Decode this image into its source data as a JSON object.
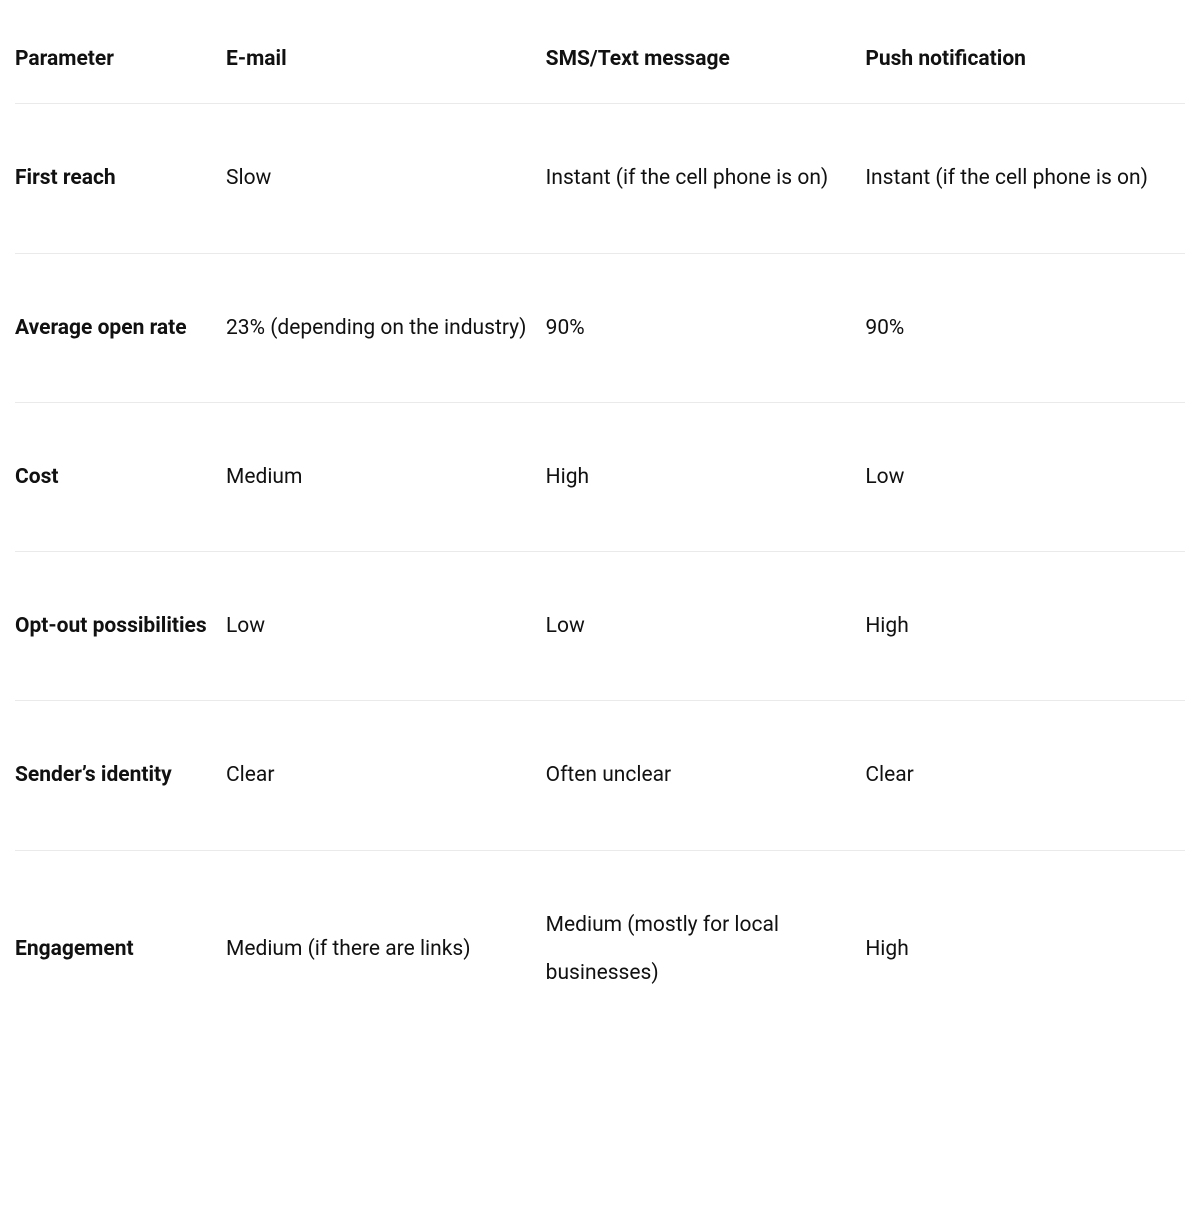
{
  "chart_data": {
    "type": "table",
    "title": "",
    "columns": [
      "Parameter",
      "E-mail",
      "SMS/Text message",
      "Push notification"
    ],
    "rows": [
      {
        "parameter": "First reach",
        "email": "Slow",
        "sms": "Instant (if the cell phone is on)",
        "push": "Instant (if the cell phone is on)"
      },
      {
        "parameter": "Average open rate",
        "email": "23% (depending on the industry)",
        "sms": "90%",
        "push": "90%"
      },
      {
        "parameter": "Cost",
        "email": "Medium",
        "sms": "High",
        "push": "Low"
      },
      {
        "parameter": "Opt-out possibilities",
        "email": "Low",
        "sms": "Low",
        "push": "High"
      },
      {
        "parameter": "Sender’s identity",
        "email": "Clear",
        "sms": "Often unclear",
        "push": "Clear"
      },
      {
        "parameter": "Engagement",
        "email": "Medium (if there are links)",
        "sms": "Medium (mostly for local businesses)",
        "push": "High"
      }
    ]
  }
}
